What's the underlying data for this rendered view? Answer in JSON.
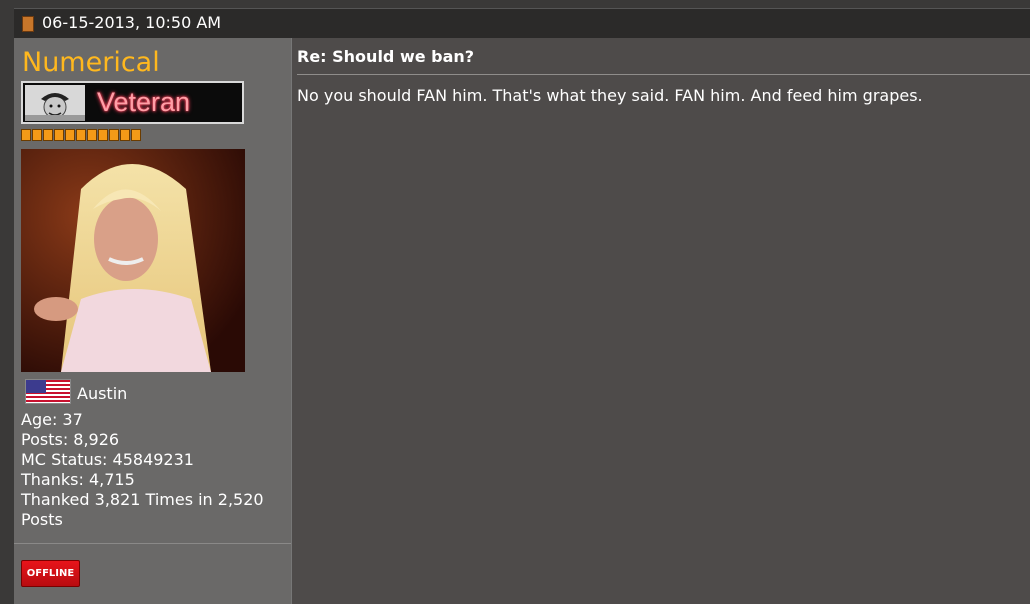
{
  "post": {
    "date": "06-15-2013, 10:50 AM",
    "title": "Re: Should we ban?",
    "message": "No you should FAN him. That's what they said. FAN him. And feed him grapes."
  },
  "user": {
    "name": "Numerical",
    "rank": "Veteran",
    "reputation_pips": 11,
    "location": "Austin",
    "stats": {
      "age": "Age: 37",
      "posts": "Posts: 8,926",
      "mc_status": "MC Status: 45849231",
      "thanks": "Thanks: 4,715",
      "thanked": "Thanked 3,821 Times in 2,520 Posts"
    },
    "status": "OFFLINE"
  },
  "colors": {
    "username": "#ffb81e",
    "rank_text": "#ff9ea6",
    "reputation": "#f39a17",
    "offline": "#e8141a"
  }
}
